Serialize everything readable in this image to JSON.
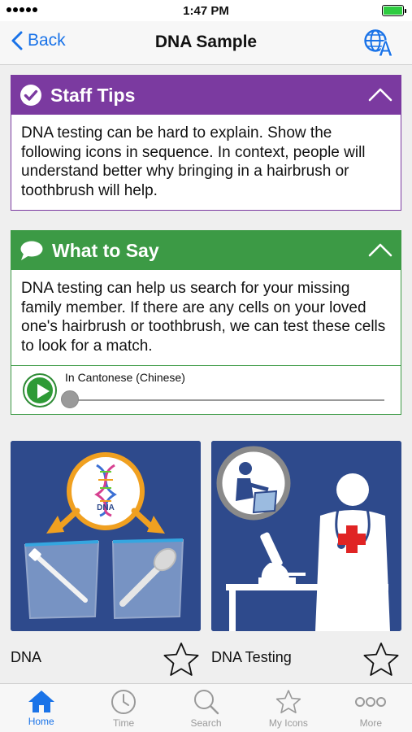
{
  "status_bar": {
    "time": "1:47 PM",
    "signal_icon": "signal-dots-icon",
    "battery_icon": "battery-icon"
  },
  "nav": {
    "back_label": "Back",
    "title": "DNA Sample",
    "translate_icon": "globe-translate-icon"
  },
  "staff_tips": {
    "title": "Staff Tips",
    "icon": "checkmark-icon",
    "body": "DNA testing can be hard to explain. Show the following icons in sequence. In context, people will understand better why bringing in a hairbrush or toothbrush will help.",
    "color": "#7b3aa0"
  },
  "what_to_say": {
    "title": "What to Say",
    "icon": "speech-bubble-icon",
    "body": "DNA testing can help us search for your missing family member. If there are any cells on your loved one's hairbrush or toothbrush, we can test these cells to look for a match.",
    "color": "#3c9a45",
    "audio": {
      "language_label": "In Cantonese (Chinese)",
      "progress": 0
    }
  },
  "cards": [
    {
      "label": "DNA",
      "image": "dna-hairbrush-toothbrush-illustration",
      "dna_text": "DNA",
      "favorite": false
    },
    {
      "label": "DNA Testing",
      "image": "doctor-microscope-illustration",
      "favorite": false
    }
  ],
  "tabbar": {
    "items": [
      {
        "label": "Home",
        "icon": "home-icon",
        "active": true
      },
      {
        "label": "Time",
        "icon": "clock-icon",
        "active": false
      },
      {
        "label": "Search",
        "icon": "search-icon",
        "active": false
      },
      {
        "label": "My Icons",
        "icon": "star-icon",
        "active": false
      },
      {
        "label": "More",
        "icon": "more-dots-icon",
        "active": false
      }
    ]
  },
  "colors": {
    "accent": "#1a73e8",
    "card_bg": "#2e4a8c"
  }
}
